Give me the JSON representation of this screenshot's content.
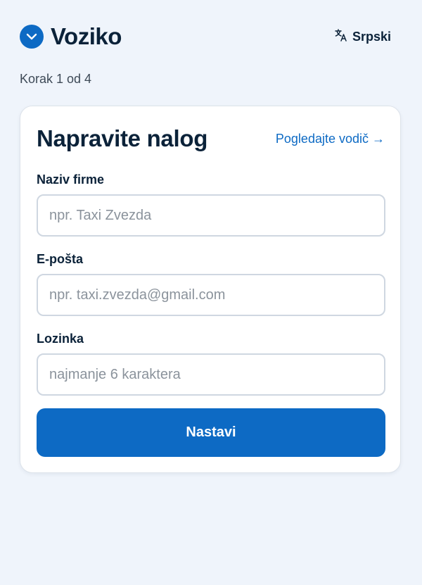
{
  "brand": {
    "name": "Voziko",
    "logo_icon": "chevron-down-icon",
    "accent_color": "#0d6ac4"
  },
  "language": {
    "label": "Srpski",
    "icon": "translate-icon"
  },
  "progress": {
    "step_text": "Korak 1 od 4",
    "current_step": 1,
    "total_steps": 4
  },
  "form": {
    "title": "Napravite nalog",
    "guide_link": "Pogledajte vodič →",
    "fields": [
      {
        "label": "Naziv firme",
        "placeholder": "npr. Taxi Zvezda",
        "value": ""
      },
      {
        "label": "E-pošta",
        "placeholder": "npr. taxi.zvezda@gmail.com",
        "value": ""
      },
      {
        "label": "Lozinka",
        "placeholder": "najmanje 6 karaktera",
        "value": ""
      }
    ],
    "submit_label": "Nastavi"
  }
}
